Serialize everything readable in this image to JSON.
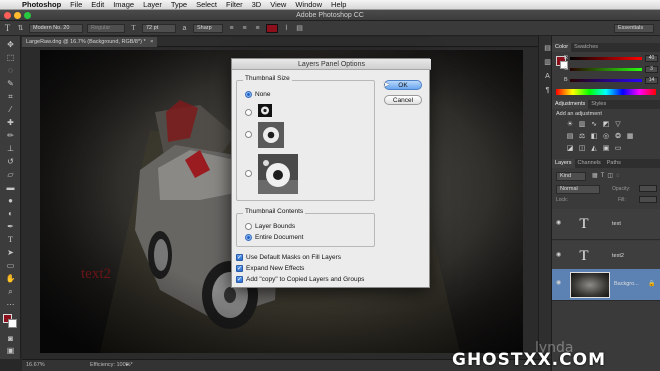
{
  "menubar": {
    "apple": "",
    "app": "Photoshop",
    "items": [
      "File",
      "Edit",
      "Image",
      "Layer",
      "Type",
      "Select",
      "Filter",
      "3D",
      "View",
      "Window",
      "Help"
    ]
  },
  "titlebar": {
    "title": "Adobe Photoshop CC"
  },
  "options": {
    "font_family": "Modern No. 20",
    "font_style": "Regular",
    "font_size": "72 pt",
    "antialias": "Sharp",
    "workspace": "Essentials"
  },
  "document": {
    "tab_label": "LargeRaw.dng @ 16.7% (Background, RGB/8*) *",
    "canvas_text": "text2"
  },
  "status": {
    "zoom": "16.67%",
    "info": "Efficiency: 100%*"
  },
  "panels": {
    "color_tabs": [
      "Color",
      "Swatches"
    ],
    "color_values": {
      "r": "40",
      "g": "3",
      "b": "14"
    },
    "adjustments_tabs": [
      "Adjustments",
      "Styles"
    ],
    "adjustments_header": "Add an adjustment",
    "layers_tabs": [
      "Layers",
      "Channels",
      "Paths"
    ],
    "layer_filter": "Kind",
    "blend_mode": "Normal",
    "opacity_label": "Opacity:",
    "fill_label": "Fill:",
    "lock_label": "Lock:",
    "layers": [
      {
        "name": "text",
        "thumb": "T",
        "selected": false
      },
      {
        "name": "text2",
        "thumb": "T",
        "selected": false
      },
      {
        "name": "Backgro...",
        "thumb": "",
        "selected": true
      }
    ]
  },
  "dialog": {
    "title": "Layers Panel Options",
    "thumb_size_label": "Thumbnail Size",
    "none_label": "None",
    "thumb_contents_label": "Thumbnail Contents",
    "layer_bounds_label": "Layer Bounds",
    "entire_document_label": "Entire Document",
    "use_default_masks_label": "Use Default Masks on Fill Layers",
    "expand_new_effects_label": "Expand New Effects",
    "add_copy_label": "Add \"copy\" to Copied Layers and Groups",
    "ok_label": "OK",
    "cancel_label": "Cancel",
    "thumbnail_size_selected": "None",
    "thumbnail_contents_selected": "Entire Document"
  },
  "watermark": {
    "text": "GHOSTXX.COM",
    "lynda": "lynda"
  },
  "colors": {
    "accent": "#5b82b3",
    "dialog_bg": "#ececec",
    "ok_button": "#6aa6ef"
  }
}
